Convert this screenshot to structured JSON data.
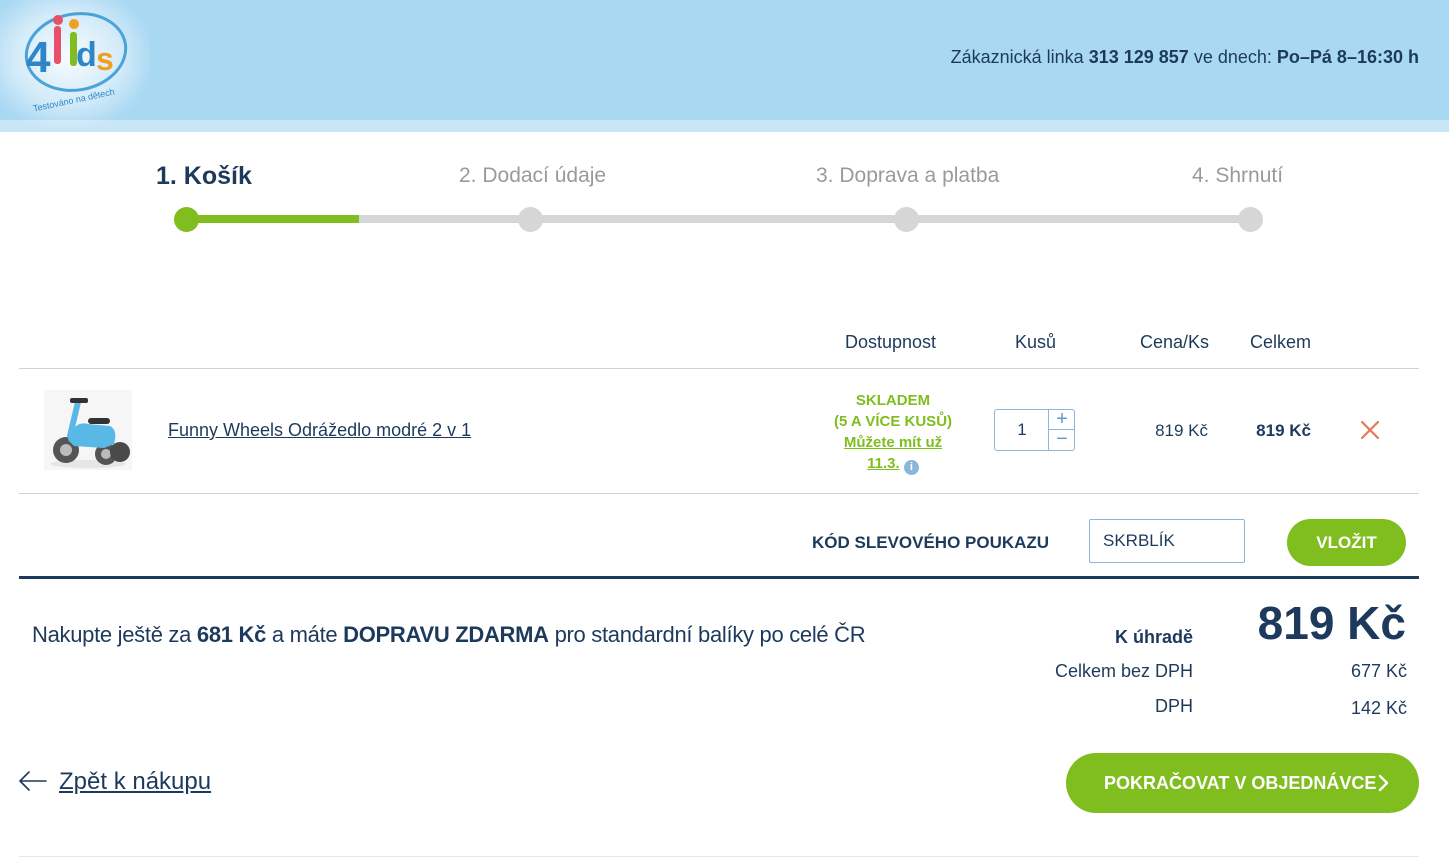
{
  "header": {
    "logo_text": "4kids",
    "logo_tagline": "Testováno na dětech",
    "hotline_prefix": "Zákaznická linka",
    "hotline_phone": "313 129 857",
    "hotline_middle": "ve dnech:",
    "hotline_hours": "Po–Pá 8–16:30 h"
  },
  "steps": [
    {
      "label": "1. Košík",
      "active": true
    },
    {
      "label": "2. Dodací údaje",
      "active": false
    },
    {
      "label": "3. Doprava a platba",
      "active": false
    },
    {
      "label": "4. Shrnutí",
      "active": false
    }
  ],
  "table": {
    "headers": {
      "availability": "Dostupnost",
      "quantity": "Kusů",
      "unit_price": "Cena/Ks",
      "total": "Celkem"
    },
    "items": [
      {
        "name": "Funny Wheels Odrážedlo modré 2 v 1",
        "availability_status": "SKLADEM",
        "availability_detail": "(5 A VÍCE KUSŮ)",
        "availability_link": "Můžete mít už",
        "availability_date": "11.3.",
        "quantity": "1",
        "unit_price": "819 Kč",
        "total": "819 Kč"
      }
    ]
  },
  "voucher": {
    "label": "KÓD SLEVOVÉHO POUKAZU",
    "value": "SKRBLÍK",
    "button": "VLOŽIT"
  },
  "free_shipping": {
    "prefix": "Nakupte ještě za",
    "amount": "681 Kč",
    "middle": "a máte",
    "highlight": "DOPRAVU ZDARMA",
    "suffix": "pro standardní balíky po celé ČR"
  },
  "summary": {
    "to_pay_label": "K úhradě",
    "to_pay_value": "819 Kč",
    "without_vat_label": "Celkem bez DPH",
    "without_vat_value": "677 Kč",
    "vat_label": "DPH",
    "vat_value": "142 Kč"
  },
  "actions": {
    "back": "Zpět k nákupu",
    "continue": "POKRAČOVAT V OBJEDNÁVCE"
  },
  "colors": {
    "navy": "#1d3a5c",
    "green": "#80bd1f",
    "header_blue": "#a9d8f3",
    "remove_red": "#e8765a"
  },
  "icons": {
    "remove": "close-icon",
    "back": "arrow-left-icon",
    "continue": "chevron-right-icon",
    "info": "info-icon"
  }
}
